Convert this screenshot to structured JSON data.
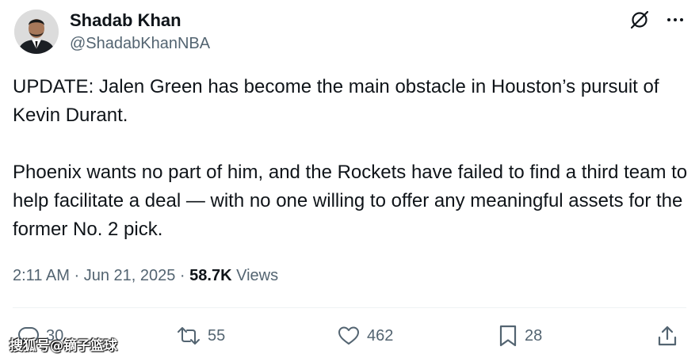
{
  "author": {
    "name": "Shadab Khan",
    "handle": "@ShadabKhanNBA"
  },
  "top_icons": [
    "grok-slash-icon",
    "more-options-icon"
  ],
  "tweet": {
    "paragraphs": [
      "UPDATE: Jalen Green has become the main obstacle in Houston’s pursuit of Kevin Durant.",
      "Phoenix wants no part of him, and the Rockets have failed to find a third team to help facilitate a deal — with no one willing to offer any meaningful assets for the former No. 2 pick."
    ]
  },
  "meta": {
    "time": "2:11 AM",
    "separator": "·",
    "date": "Jun 21, 2025",
    "views_count": "58.7K",
    "views_label": "Views"
  },
  "actions": {
    "replies": "30",
    "reposts": "55",
    "likes": "462",
    "bookmarks": "28"
  },
  "watermark": "搜狐号@镝子篮球",
  "colors": {
    "text": "#0f1419",
    "secondary": "#536471",
    "divider": "#eff3f4"
  }
}
